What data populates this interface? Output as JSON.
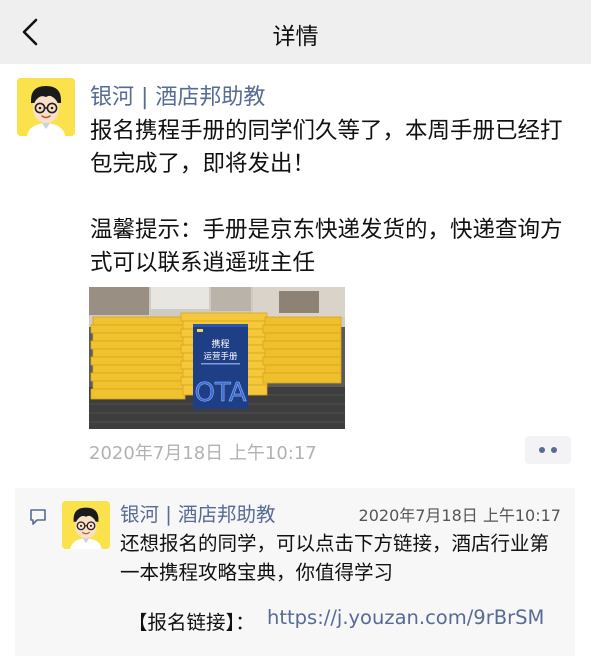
{
  "nav": {
    "title": "详情"
  },
  "post": {
    "author": "银河 | 酒店邦助教",
    "text": "报名携程手册的同学们久等了，本周手册已经打包完成了，即将发出！\n\n温馨提示：手册是京东快递发货的，快递查询方式可以联系逍遥班主任",
    "timestamp": "2020年7月18日 上午10:17"
  },
  "photo": {
    "book_title_line1": "携程",
    "book_title_line2": "运营手册",
    "book_subtitle": "OTA"
  },
  "comment": {
    "author": "银河 | 酒店邦助教",
    "time": "2020年7月18日 上午10:17",
    "text": "还想报名的同学，可以点击下方链接，酒店行业第一本携程攻略宝典，你值得学习",
    "link_label": "【报名链接】：",
    "link_url": "https://j.youzan.com/9rBrSM"
  },
  "colors": {
    "nav_bg": "#efefef",
    "link_blue": "#576b95",
    "avatar_yellow": "#fbe24c",
    "comment_bg": "#f7f7f7"
  },
  "icons": [
    "back-chevron-icon",
    "more-dots-icon",
    "comment-bubble-icon"
  ]
}
